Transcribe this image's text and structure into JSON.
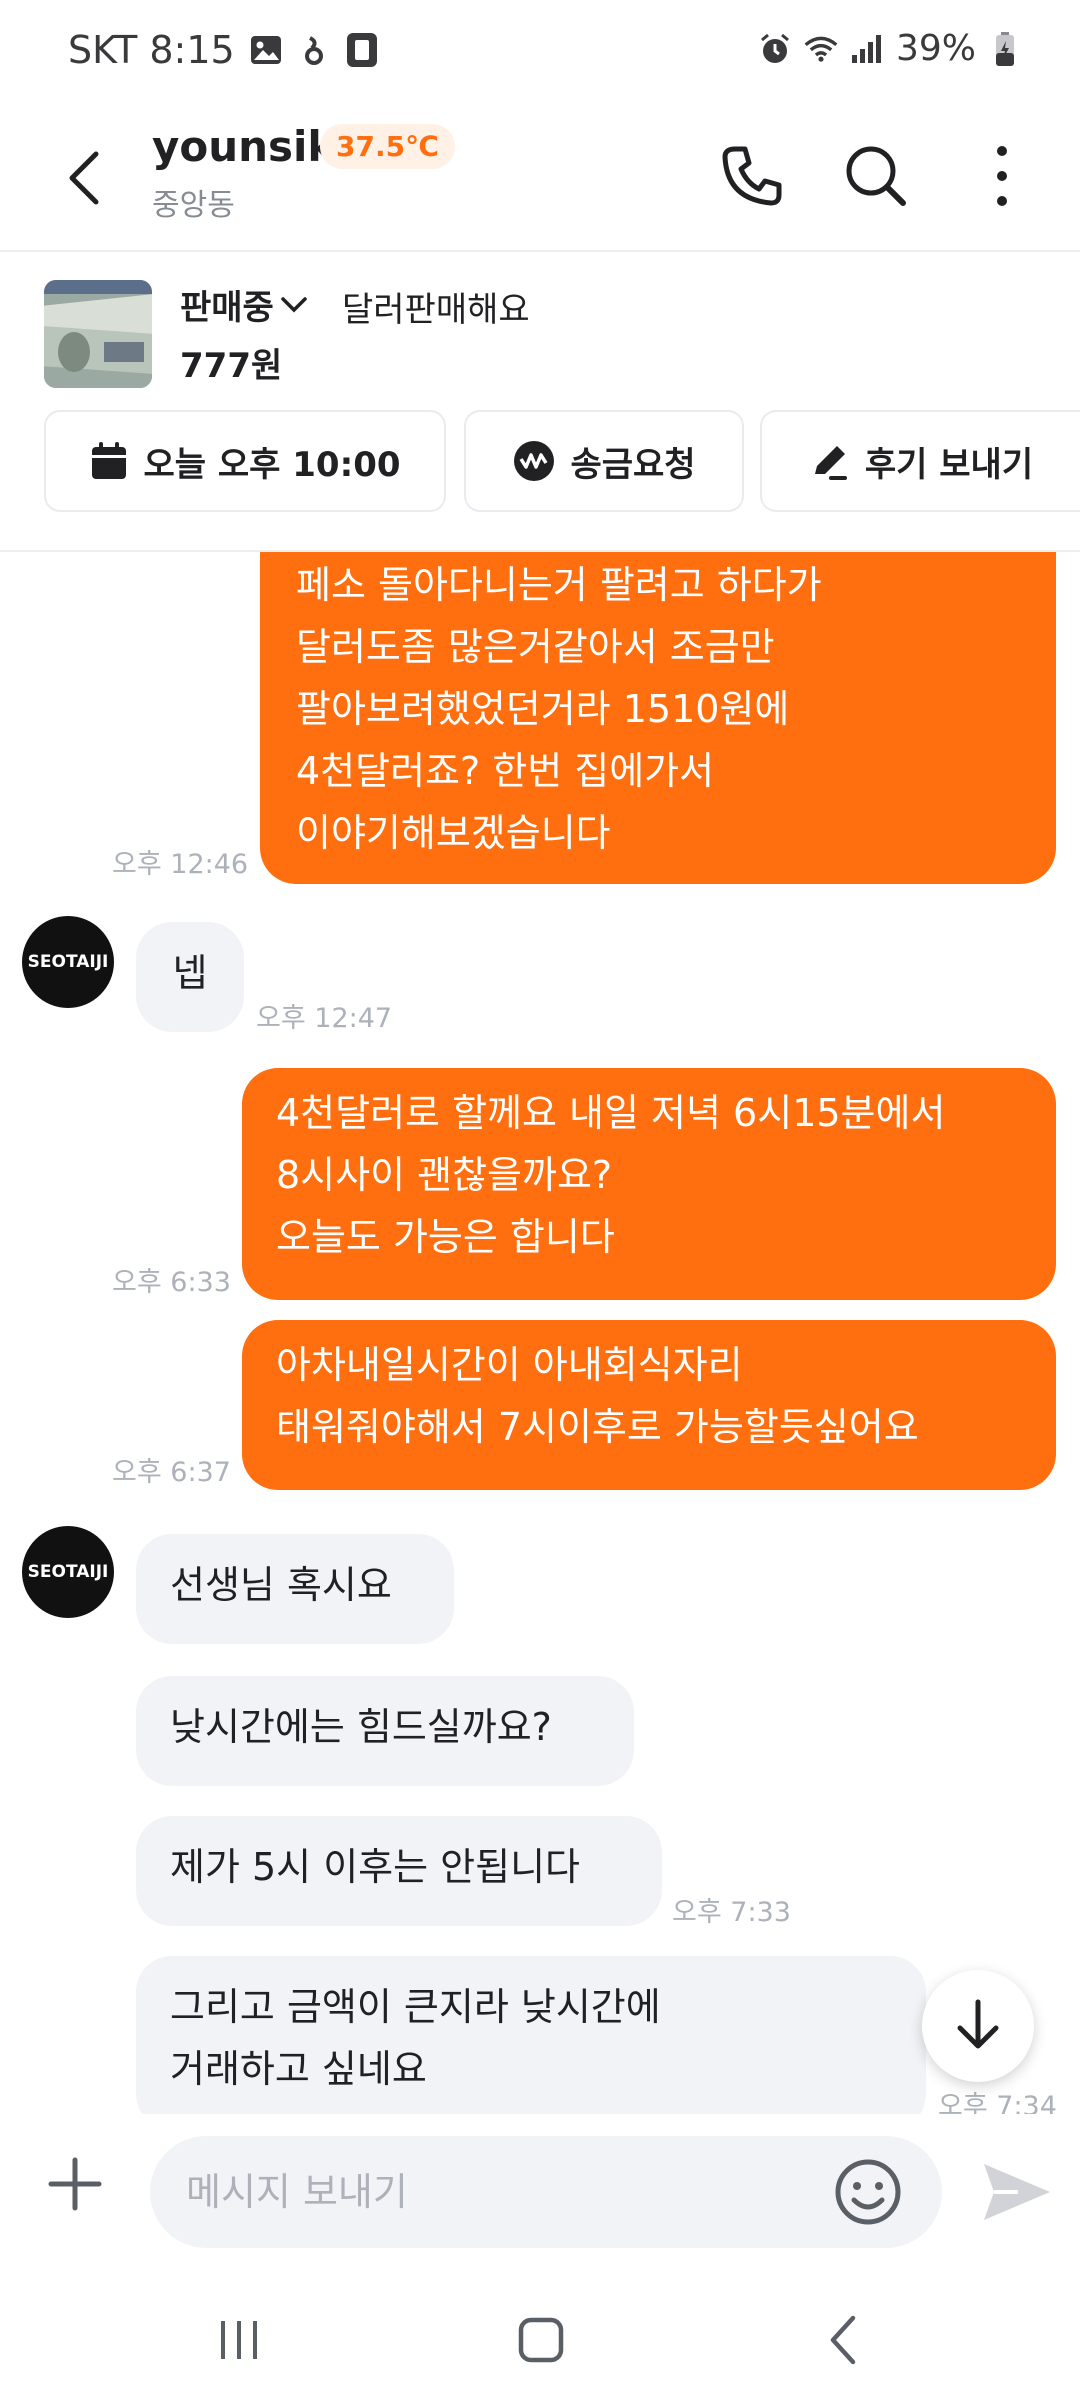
{
  "status_bar": {
    "carrier_time": "SKT 8:15",
    "battery": "39%",
    "icons": [
      "gallery-icon",
      "notification-icon",
      "phone-icon",
      "alarm-icon",
      "wifi-icon",
      "signal-icon",
      "battery-icon"
    ]
  },
  "header": {
    "name": "younsik",
    "temperature": "37.5℃",
    "location": "중앙동"
  },
  "product": {
    "status": "판매중",
    "title": "달러판매해요",
    "price": "777원"
  },
  "actions": {
    "schedule": "오늘 오후 10:00",
    "transfer": "송금요청",
    "review": "후기 보내기"
  },
  "avatar_label": "SEOTAIJI",
  "messages": [
    {
      "dir": "out",
      "text": "페소 돌아다니는거 팔려고 하다가\n달러도좀 많은거같아서 조금만\n팔아보려했었던거라 1510원에\n4천달러죠? 한번 집에가서\n이야기해보겠습니다",
      "time": "오후 12:46"
    },
    {
      "dir": "in",
      "text": "넵",
      "time": "오후 12:47"
    },
    {
      "dir": "out",
      "text": "4천달러로 할께요 내일 저녁 6시15분에서\n8시사이 괜찮을까요?\n오늘도 가능은 합니다",
      "time": "오후 6:33"
    },
    {
      "dir": "out",
      "text": "아차내일시간이 아내회식자리\n태워줘야해서 7시이후로 가능할듯싶어요",
      "time": "오후 6:37"
    },
    {
      "dir": "in",
      "text": "선생님 혹시요",
      "time": ""
    },
    {
      "dir": "in",
      "text": "낮시간에는 힘드실까요?",
      "time": ""
    },
    {
      "dir": "in",
      "text": "제가 5시 이후는 안됩니다",
      "time": "오후 7:33"
    },
    {
      "dir": "in",
      "text": "그리고 금액이 큰지라 낮시간에\n거래하고 싶네요",
      "time": "오후 7:34"
    }
  ],
  "composer": {
    "placeholder": "메시지 보내기"
  },
  "colors": {
    "accent": "#ff6f0f",
    "incoming_bubble": "#f2f3f6",
    "timestamp": "#adb1ba"
  }
}
